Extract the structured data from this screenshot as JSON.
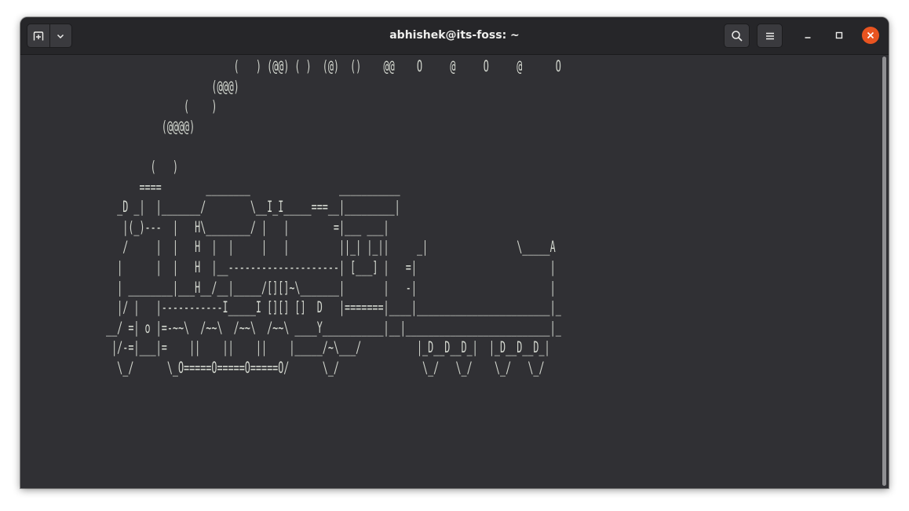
{
  "window": {
    "title": "abhishek@its-foss: ~",
    "accent_close": "#e95420",
    "background": "#303034"
  },
  "toolbar": {
    "new_tab_icon": "new-tab-icon",
    "dropdown_icon": "chevron-down-icon",
    "search_icon": "search-icon",
    "menu_icon": "hamburger-menu-icon",
    "minimize_icon": "minimize-icon",
    "maximize_icon": "maximize-icon",
    "close_icon": "close-icon"
  },
  "terminal": {
    "output": "                                      (   ) (@@) ( )  (@)  ()    @@    O     @     O     @      O\n                                  (@@@)\n                             (    )\n                         (@@@@)\n\n                       (   )\n                     ====        ________                ___________\n                 _D _|  |_______/        \\__I_I_____===__|_________|\n                  |(_)---  |   H\\________/ |   |        =|___ ___|\n                  /     |  |   H  |  |     |   |         ||_| |_||     _|                \\_____A\n                 |      |  |   H  |__--------------------| [___] |   =|                        |\n                 | ________|___H__/__|_____/[][]~\\_______|       |   -|                        |\n                 |/ |   |-----------I_____I [][] []  D   |=======|____|________________________|_\n               __/ =| o |=-~~\\  /~~\\  /~~\\  /~~\\ ____Y___________|__|__________________________|_\n                |/-=|___|=    ||    ||    ||    |_____/~\\___/          |_D__D__D_|  |_D__D__D_|\n                 \\_/      \\_O=====O=====O=====O/      \\_/               \\_/   \\_/    \\_/   \\_/"
  }
}
